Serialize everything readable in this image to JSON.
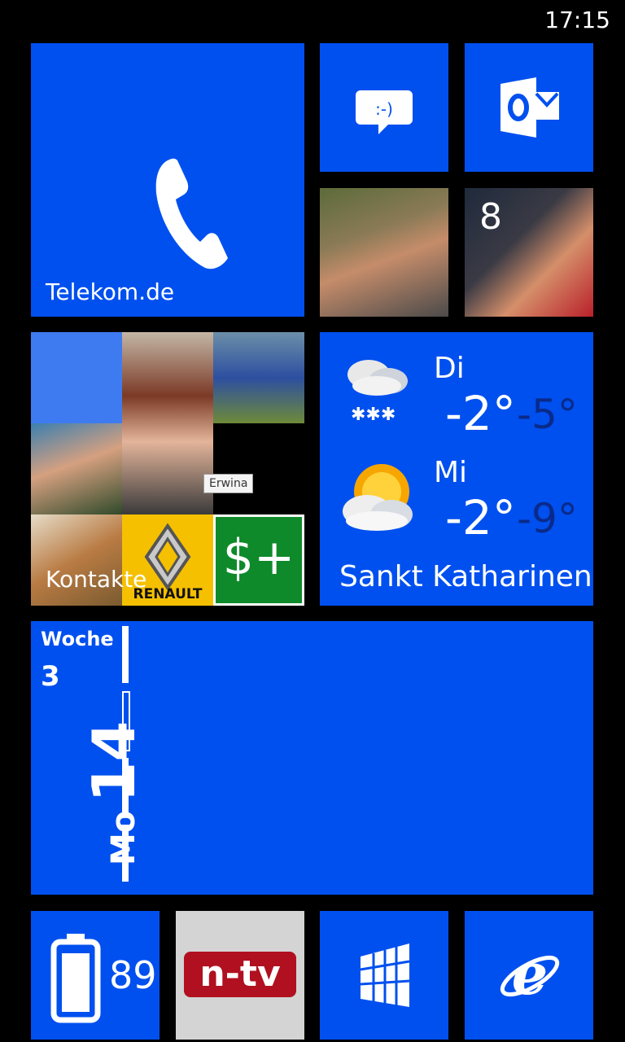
{
  "status": {
    "time": "17:15"
  },
  "phone_tile": {
    "label": "Telekom.de",
    "icon": "phone-icon"
  },
  "messaging_tile": {
    "icon": "messaging-icon",
    "glyph": ":-)"
  },
  "outlook_tile": {
    "icon": "outlook-icon",
    "glyph": "O"
  },
  "people_tile_2": {
    "badge": "8"
  },
  "contacts_tile": {
    "label": "Kontakte",
    "tooltip": "Erwina",
    "logo_text": "RENAULT",
    "health_symbol": "$+"
  },
  "weather_tile": {
    "days": [
      {
        "day": "Di",
        "high": "-2°",
        "low": "-5°",
        "icon": "snow-cloud-icon"
      },
      {
        "day": "Mi",
        "high": "-2°",
        "low": "-9°",
        "icon": "sun-cloud-icon"
      }
    ],
    "city": "Sankt Katharinen("
  },
  "calendar_tile": {
    "week_label": "Woche",
    "week_number": "3",
    "weekday": "Mo",
    "day": "14"
  },
  "battery_tile": {
    "value": "89",
    "icon": "battery-icon"
  },
  "ntv_tile": {
    "logo": "n-tv"
  },
  "store_tile": {
    "icon": "store-icon"
  },
  "ie_tile": {
    "icon": "internet-explorer-icon"
  },
  "colors": {
    "accent": "#0050ef",
    "background": "#000000"
  }
}
